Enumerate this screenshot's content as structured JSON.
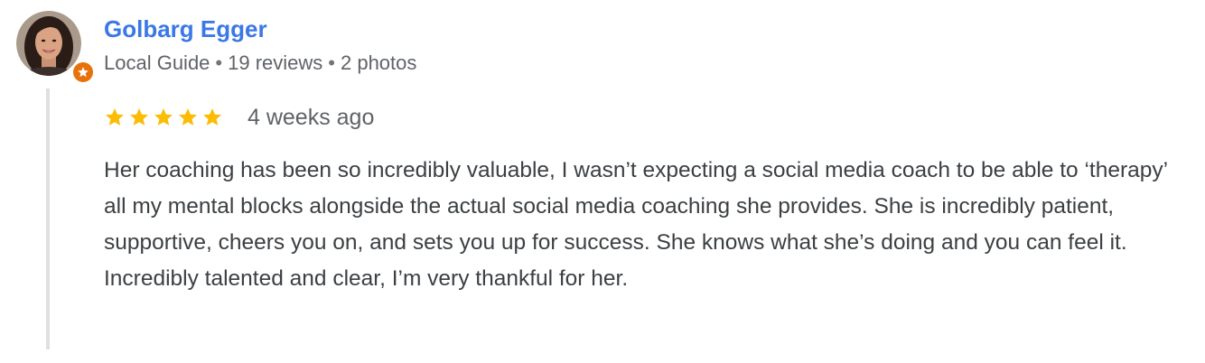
{
  "review": {
    "author": {
      "name": "Golbarg Egger",
      "avatar_icon": "user-avatar-photo",
      "badge_icon": "local-guide-star-icon",
      "badge_color": "#e8710a",
      "role": "Local Guide",
      "reviews": "19 reviews",
      "photos": "2 photos",
      "separator": "•"
    },
    "rating": 5,
    "star_color": "#fbbc04",
    "date": "4 weeks ago",
    "text": "Her coaching has been so incredibly valuable, I wasn’t expecting a social media coach to be able to ‘therapy’ all my mental blocks alongside the actual social media coaching she provides. She is incredibly patient, supportive, cheers you on, and sets you up for success. She knows what she’s doing and you can feel it. Incredibly talented and clear, I’m very thankful for her."
  },
  "colors": {
    "name": "#3b78e7",
    "meta": "#5f6368",
    "body": "#3c4043",
    "thread_line": "#e0e0e0"
  }
}
